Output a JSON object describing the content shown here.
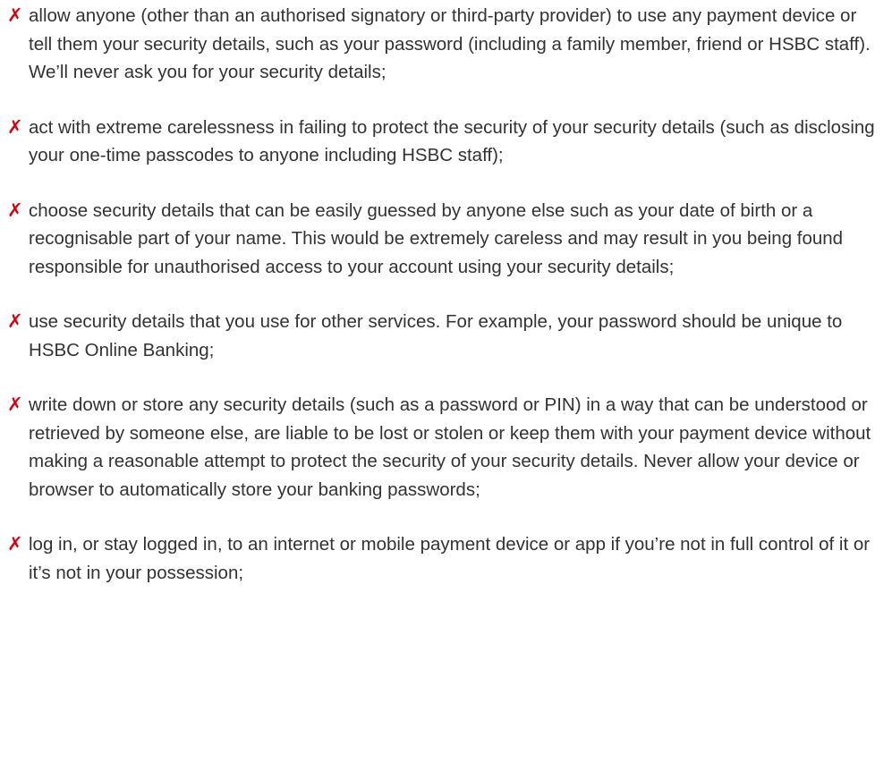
{
  "marker": {
    "symbol": "✗",
    "color": "#db0011",
    "icon": "cross-icon"
  },
  "items": [
    {
      "text": "allow anyone (other than an authorised signatory or third-party provider) to use any payment device or tell them your security details, such as your password (including a family member, friend or HSBC staff). We’ll never ask you for your security details;"
    },
    {
      "text": "act with extreme carelessness in failing to protect the security of your security details (such as disclosing your one-time passcodes to anyone including HSBC staff);"
    },
    {
      "text": "choose security details that can be easily guessed by anyone else such as your date of birth or a recognisable part of your name. This would be extremely careless and may result in you being found responsible for unauthorised access to your account using your security details;"
    },
    {
      "text": "use security details that you use for other services. For example, your password should be unique to HSBC Online Banking;"
    },
    {
      "text": "write down or store any security details (such as a password or PIN) in a way that can be understood or retrieved by someone else, are liable to be lost or stolen or keep them with your payment device without making a reasonable attempt to protect the security of your security details. Never allow your device or browser to automatically store your banking passwords;"
    },
    {
      "text": "log in, or stay logged in, to an internet or mobile payment device or app if you’re not in full control of it or it’s not in your possession;"
    }
  ]
}
